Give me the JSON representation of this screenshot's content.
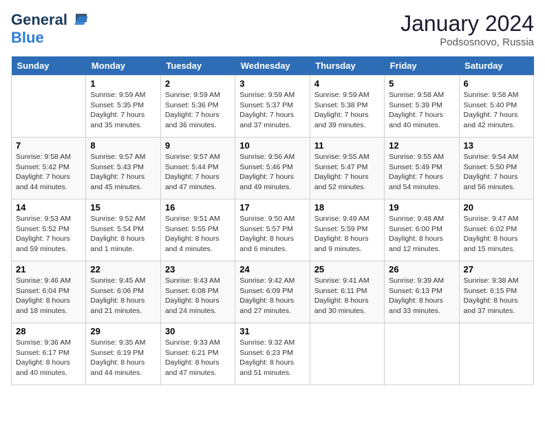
{
  "logo": {
    "general": "General",
    "blue": "Blue"
  },
  "header": {
    "month": "January 2024",
    "location": "Podsosnovo, Russia"
  },
  "weekdays": [
    "Sunday",
    "Monday",
    "Tuesday",
    "Wednesday",
    "Thursday",
    "Friday",
    "Saturday"
  ],
  "weeks": [
    [
      {
        "day": "",
        "info": ""
      },
      {
        "day": "1",
        "info": "Sunrise: 9:59 AM\nSunset: 5:35 PM\nDaylight: 7 hours\nand 35 minutes."
      },
      {
        "day": "2",
        "info": "Sunrise: 9:59 AM\nSunset: 5:36 PM\nDaylight: 7 hours\nand 36 minutes."
      },
      {
        "day": "3",
        "info": "Sunrise: 9:59 AM\nSunset: 5:37 PM\nDaylight: 7 hours\nand 37 minutes."
      },
      {
        "day": "4",
        "info": "Sunrise: 9:59 AM\nSunset: 5:38 PM\nDaylight: 7 hours\nand 39 minutes."
      },
      {
        "day": "5",
        "info": "Sunrise: 9:58 AM\nSunset: 5:39 PM\nDaylight: 7 hours\nand 40 minutes."
      },
      {
        "day": "6",
        "info": "Sunrise: 9:58 AM\nSunset: 5:40 PM\nDaylight: 7 hours\nand 42 minutes."
      }
    ],
    [
      {
        "day": "7",
        "info": "Sunrise: 9:58 AM\nSunset: 5:42 PM\nDaylight: 7 hours\nand 44 minutes."
      },
      {
        "day": "8",
        "info": "Sunrise: 9:57 AM\nSunset: 5:43 PM\nDaylight: 7 hours\nand 45 minutes."
      },
      {
        "day": "9",
        "info": "Sunrise: 9:57 AM\nSunset: 5:44 PM\nDaylight: 7 hours\nand 47 minutes."
      },
      {
        "day": "10",
        "info": "Sunrise: 9:56 AM\nSunset: 5:46 PM\nDaylight: 7 hours\nand 49 minutes."
      },
      {
        "day": "11",
        "info": "Sunrise: 9:55 AM\nSunset: 5:47 PM\nDaylight: 7 hours\nand 52 minutes."
      },
      {
        "day": "12",
        "info": "Sunrise: 9:55 AM\nSunset: 5:49 PM\nDaylight: 7 hours\nand 54 minutes."
      },
      {
        "day": "13",
        "info": "Sunrise: 9:54 AM\nSunset: 5:50 PM\nDaylight: 7 hours\nand 56 minutes."
      }
    ],
    [
      {
        "day": "14",
        "info": "Sunrise: 9:53 AM\nSunset: 5:52 PM\nDaylight: 7 hours\nand 59 minutes."
      },
      {
        "day": "15",
        "info": "Sunrise: 9:52 AM\nSunset: 5:54 PM\nDaylight: 8 hours\nand 1 minute."
      },
      {
        "day": "16",
        "info": "Sunrise: 9:51 AM\nSunset: 5:55 PM\nDaylight: 8 hours\nand 4 minutes."
      },
      {
        "day": "17",
        "info": "Sunrise: 9:50 AM\nSunset: 5:57 PM\nDaylight: 8 hours\nand 6 minutes."
      },
      {
        "day": "18",
        "info": "Sunrise: 9:49 AM\nSunset: 5:59 PM\nDaylight: 8 hours\nand 9 minutes."
      },
      {
        "day": "19",
        "info": "Sunrise: 9:48 AM\nSunset: 6:00 PM\nDaylight: 8 hours\nand 12 minutes."
      },
      {
        "day": "20",
        "info": "Sunrise: 9:47 AM\nSunset: 6:02 PM\nDaylight: 8 hours\nand 15 minutes."
      }
    ],
    [
      {
        "day": "21",
        "info": "Sunrise: 9:46 AM\nSunset: 6:04 PM\nDaylight: 8 hours\nand 18 minutes."
      },
      {
        "day": "22",
        "info": "Sunrise: 9:45 AM\nSunset: 6:06 PM\nDaylight: 8 hours\nand 21 minutes."
      },
      {
        "day": "23",
        "info": "Sunrise: 9:43 AM\nSunset: 6:08 PM\nDaylight: 8 hours\nand 24 minutes."
      },
      {
        "day": "24",
        "info": "Sunrise: 9:42 AM\nSunset: 6:09 PM\nDaylight: 8 hours\nand 27 minutes."
      },
      {
        "day": "25",
        "info": "Sunrise: 9:41 AM\nSunset: 6:11 PM\nDaylight: 8 hours\nand 30 minutes."
      },
      {
        "day": "26",
        "info": "Sunrise: 9:39 AM\nSunset: 6:13 PM\nDaylight: 8 hours\nand 33 minutes."
      },
      {
        "day": "27",
        "info": "Sunrise: 9:38 AM\nSunset: 6:15 PM\nDaylight: 8 hours\nand 37 minutes."
      }
    ],
    [
      {
        "day": "28",
        "info": "Sunrise: 9:36 AM\nSunset: 6:17 PM\nDaylight: 8 hours\nand 40 minutes."
      },
      {
        "day": "29",
        "info": "Sunrise: 9:35 AM\nSunset: 6:19 PM\nDaylight: 8 hours\nand 44 minutes."
      },
      {
        "day": "30",
        "info": "Sunrise: 9:33 AM\nSunset: 6:21 PM\nDaylight: 8 hours\nand 47 minutes."
      },
      {
        "day": "31",
        "info": "Sunrise: 9:32 AM\nSunset: 6:23 PM\nDaylight: 8 hours\nand 51 minutes."
      },
      {
        "day": "",
        "info": ""
      },
      {
        "day": "",
        "info": ""
      },
      {
        "day": "",
        "info": ""
      }
    ]
  ]
}
